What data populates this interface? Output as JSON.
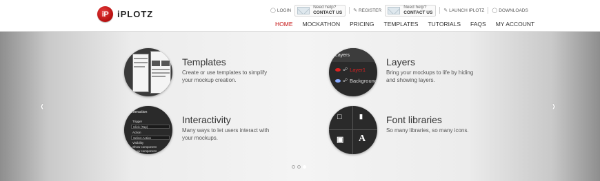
{
  "brand": {
    "logo_mark": "iP",
    "logo_text": "iPLOTZ"
  },
  "topbar": {
    "login": "LOGIN",
    "help1_small": "Need help?",
    "help1_big": "CONTACT US",
    "register": "REGISTER",
    "help2_small": "Need help?",
    "help2_big": "CONTACT US",
    "launch": "LAUNCH IPLOTZ",
    "downloads": "DOWNLOADS"
  },
  "nav": {
    "home": "HOME",
    "mockathon": "MOCKATHON",
    "pricing": "PRICING",
    "templates": "TEMPLATES",
    "tutorials": "TUTORIALS",
    "faqs": "FAQS",
    "account": "MY ACCOUNT"
  },
  "features": {
    "templates": {
      "title": "Templates",
      "desc": "Create or use templates to simplify your mockup creation."
    },
    "layers": {
      "title": "Layers",
      "desc": "Bring your mockups to life by hiding and showing layers.",
      "panel_title": "Layers",
      "layer1": "Layer1",
      "layer2": "Background"
    },
    "interactivity": {
      "title": "Interactivity",
      "desc": "Many ways to let users interact with your mockups.",
      "panel_title": "Interaction",
      "trigger": "Trigger",
      "trigger_value": "Click (Tap)",
      "action": "Action",
      "action_value": "Select Action",
      "visibility": "Visibility",
      "show1": "Show component",
      "show2": "Show component"
    },
    "fonts": {
      "title": "Font libraries",
      "desc": "So many libraries, so many icons.",
      "letter": "A"
    }
  },
  "slider": {
    "prev": "‹",
    "next": "›",
    "slide_count": 3,
    "active_slide": 3
  },
  "colors": {
    "accent": "#c40f0f"
  }
}
